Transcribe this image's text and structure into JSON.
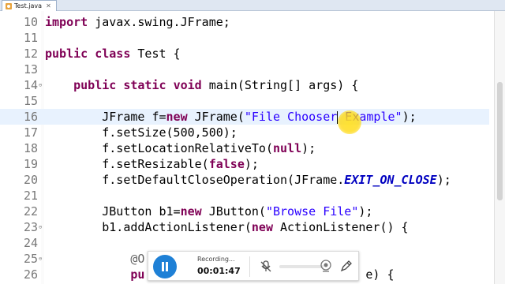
{
  "tab": {
    "title": "Test.java",
    "close": "✕"
  },
  "lines": [
    {
      "num": "10",
      "fold": "",
      "segs": [
        [
          "kw",
          "import"
        ],
        [
          "n",
          " javax.swing.JFrame;"
        ]
      ]
    },
    {
      "num": "11",
      "fold": "",
      "segs": []
    },
    {
      "num": "12",
      "fold": "",
      "segs": [
        [
          "kw",
          "public"
        ],
        [
          "n",
          " "
        ],
        [
          "kw",
          "class"
        ],
        [
          "n",
          " Test {"
        ]
      ]
    },
    {
      "num": "13",
      "fold": "",
      "segs": []
    },
    {
      "num": "14",
      "fold": "⊖",
      "segs": [
        [
          "n",
          "    "
        ],
        [
          "kw",
          "public"
        ],
        [
          "n",
          " "
        ],
        [
          "kw",
          "static"
        ],
        [
          "n",
          " "
        ],
        [
          "kw",
          "void"
        ],
        [
          "n",
          " main(String[] args) {"
        ]
      ]
    },
    {
      "num": "15",
      "fold": "",
      "segs": []
    },
    {
      "num": "16",
      "fold": "",
      "current": true,
      "segs": [
        [
          "n",
          "        JFrame f="
        ],
        [
          "kw",
          "new"
        ],
        [
          "n",
          " JFrame("
        ],
        [
          "str",
          "\"File Chooser"
        ],
        [
          "caret",
          ""
        ],
        [
          "str",
          " Example\""
        ],
        [
          "n",
          ");"
        ]
      ]
    },
    {
      "num": "17",
      "fold": "",
      "segs": [
        [
          "n",
          "        f.setSize(500,500);"
        ]
      ]
    },
    {
      "num": "18",
      "fold": "",
      "segs": [
        [
          "n",
          "        f.setLocationRelativeTo("
        ],
        [
          "kw",
          "null"
        ],
        [
          "n",
          ");"
        ]
      ]
    },
    {
      "num": "19",
      "fold": "",
      "segs": [
        [
          "n",
          "        f.setResizable("
        ],
        [
          "kw",
          "false"
        ],
        [
          "n",
          ");"
        ]
      ]
    },
    {
      "num": "20",
      "fold": "",
      "segs": [
        [
          "n",
          "        f.setDefaultCloseOperation(JFrame."
        ],
        [
          "const",
          "EXIT_ON_CLOSE"
        ],
        [
          "n",
          ");"
        ]
      ]
    },
    {
      "num": "21",
      "fold": "",
      "segs": []
    },
    {
      "num": "22",
      "fold": "",
      "segs": [
        [
          "n",
          "        JButton b1="
        ],
        [
          "kw",
          "new"
        ],
        [
          "n",
          " JButton("
        ],
        [
          "str",
          "\"Browse File\""
        ],
        [
          "n",
          ");"
        ]
      ]
    },
    {
      "num": "23",
      "fold": "⊖",
      "segs": [
        [
          "n",
          "        b1.addActionListener("
        ],
        [
          "kw",
          "new"
        ],
        [
          "n",
          " ActionListener() {"
        ]
      ]
    },
    {
      "num": "24",
      "fold": "",
      "segs": []
    },
    {
      "num": "25",
      "fold": "⊖",
      "segs": [
        [
          "n",
          "            "
        ],
        [
          "ann",
          "@O"
        ]
      ]
    },
    {
      "num": "26",
      "fold": "",
      "segs": [
        [
          "n",
          "            "
        ],
        [
          "kw",
          "pu"
        ],
        [
          "n",
          "                    "
        ],
        [
          "n",
          "ctionEvent e) {"
        ]
      ]
    }
  ],
  "recorder": {
    "status": "Recording...",
    "time": "00:01:47"
  },
  "colors": {
    "keyword": "#7f0055",
    "string": "#2a00ff",
    "constant": "#0000c0",
    "current_line": "#e8f2fe",
    "record_button": "#1e80d6"
  }
}
